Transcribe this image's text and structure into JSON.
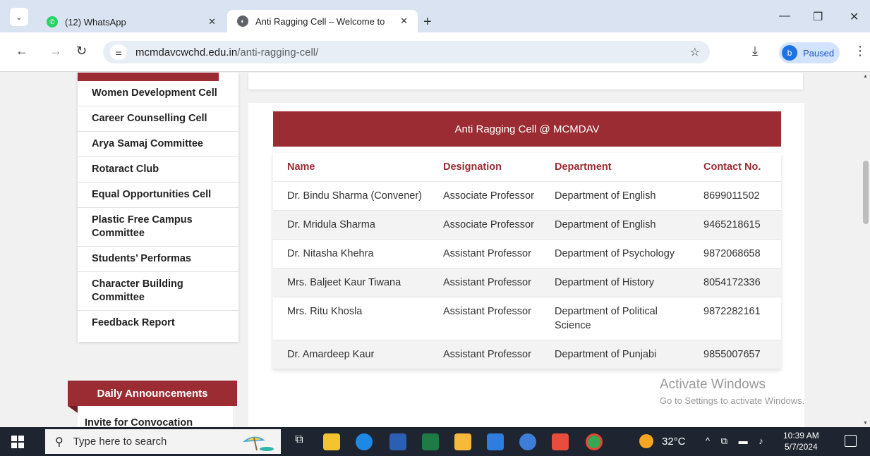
{
  "browser": {
    "tabs": [
      {
        "title": "(12) WhatsApp",
        "active": false
      },
      {
        "title": "Anti Ragging Cell – Welcome to",
        "active": true
      }
    ],
    "url_domain": "mcmdavcwchd.edu.in",
    "url_path": "/anti-ragging-cell/",
    "profile_initial": "b",
    "profile_status": "Paused"
  },
  "sidebar": {
    "items": [
      "Women Development Cell",
      "Career Counselling Cell",
      "Arya Samaj Committee",
      "Rotaract Club",
      "Equal Opportunities Cell",
      "Plastic Free Campus Committee",
      "Students’ Performas",
      "Character Building Committee",
      "Feedback Report"
    ]
  },
  "announcements": {
    "title": "Daily Announcements",
    "first_item": "Invite for Convocation"
  },
  "table": {
    "title": "Anti Ragging Cell @ MCMDAV",
    "headers": [
      "Name",
      "Designation",
      "Department",
      "Contact No."
    ],
    "rows": [
      [
        "Dr. Bindu Sharma (Convener)",
        "Associate Professor",
        "Department of English",
        "8699011502"
      ],
      [
        "Dr. Mridula Sharma",
        "Associate Professor",
        "Department of English",
        "9465218615"
      ],
      [
        "Dr. Nitasha Khehra",
        "Assistant Professor",
        "Department of Psychology",
        "9872068658"
      ],
      [
        "Mrs. Baljeet Kaur Tiwana",
        "Assistant Professor",
        "Department of History",
        "8054172336"
      ],
      [
        "Mrs. Ritu Khosla",
        "Assistant Professor",
        "Department of Political Science",
        "9872282161"
      ],
      [
        "Dr. Amardeep Kaur",
        "Assistant Professor",
        "Department of Punjabi",
        "9855007657"
      ]
    ]
  },
  "watermark": {
    "line1": "Activate Windows",
    "line2": "Go to Settings to activate Windows."
  },
  "taskbar": {
    "search_placeholder": "Type here to search",
    "temperature": "32°C",
    "time": "10:39 AM",
    "date": "5/7/2024"
  },
  "colors": {
    "brand": "#9b2c33",
    "taskbar": "#1f2530"
  }
}
